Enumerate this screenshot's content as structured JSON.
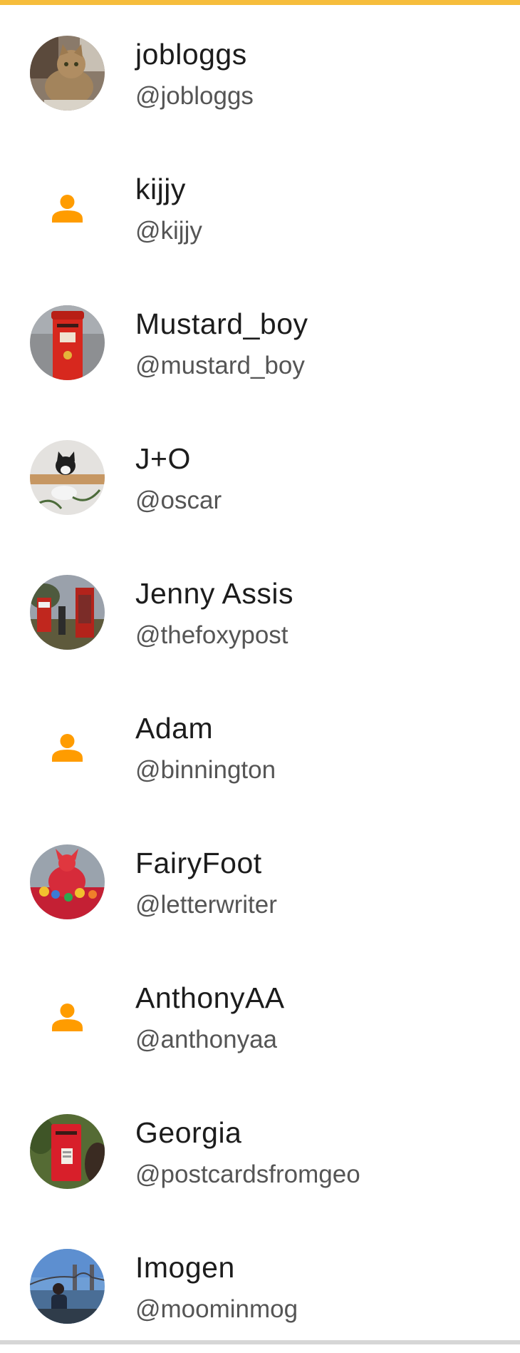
{
  "colors": {
    "accent": "#f6bd3c",
    "placeholder_icon": "#ff9c00",
    "name_text": "#1c1c1c",
    "handle_text": "#555555"
  },
  "users": [
    {
      "name": "jobloggs",
      "handle": "@jobloggs",
      "avatar": "photo-cat-icon"
    },
    {
      "name": "kijjy",
      "handle": "@kijjy",
      "avatar": "person-placeholder-icon"
    },
    {
      "name": "Mustard_boy",
      "handle": "@mustard_boy",
      "avatar": "photo-postbox-icon"
    },
    {
      "name": "J+O",
      "handle": "@oscar",
      "avatar": "photo-cat-shelf-icon"
    },
    {
      "name": "Jenny Assis",
      "handle": "@thefoxypost",
      "avatar": "photo-phonebox-icon"
    },
    {
      "name": "Adam",
      "handle": "@binnington",
      "avatar": "person-placeholder-icon"
    },
    {
      "name": "FairyFoot",
      "handle": "@letterwriter",
      "avatar": "photo-knitted-topper-icon"
    },
    {
      "name": "AnthonyAA",
      "handle": "@anthonyaa",
      "avatar": "person-placeholder-icon"
    },
    {
      "name": "Georgia",
      "handle": "@postcardsfromgeo",
      "avatar": "photo-wall-postbox-icon"
    },
    {
      "name": "Imogen",
      "handle": "@moominmog",
      "avatar": "photo-bridge-icon"
    }
  ]
}
